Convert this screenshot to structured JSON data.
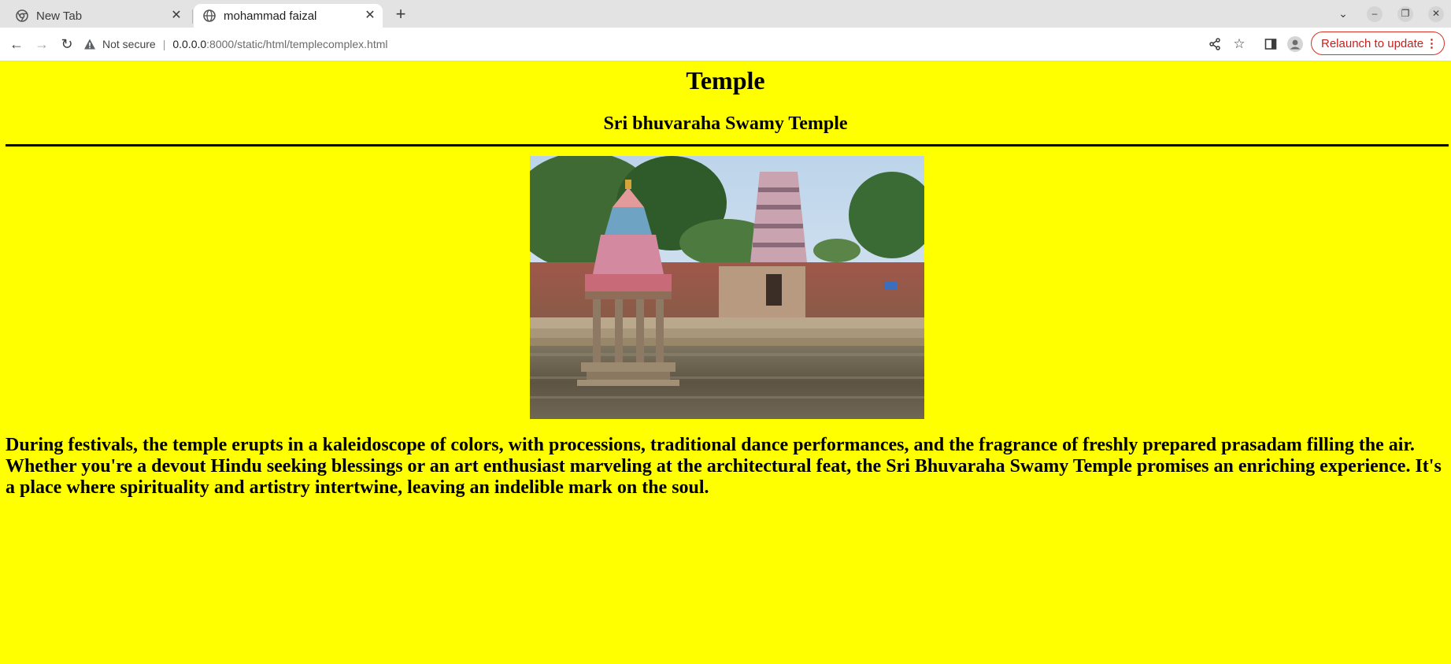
{
  "browser": {
    "tabs": [
      {
        "title": "New Tab",
        "icon": "chrome-icon",
        "active": false
      },
      {
        "title": "mohammad faizal",
        "icon": "globe-icon",
        "active": true
      }
    ],
    "security_label": "Not secure",
    "url_host": "0.0.0.0",
    "url_path": ":8000/static/html/templecomplex.html",
    "relaunch_label": "Relaunch to update"
  },
  "page": {
    "heading": "Temple",
    "subheading": "Sri bhuvaraha Swamy Temple",
    "paragraph": "During festivals, the temple erupts in a kaleidoscope of colors, with processions, traditional dance performances, and the fragrance of freshly prepared prasadam filling the air. Whether you're a devout Hindu seeking blessings or an art enthusiast marveling at the architectural feat, the Sri Bhuvaraha Swamy Temple promises an enriching experience. It's a place where spirituality and artistry intertwine, leaving an indelible mark on the soul.",
    "background_color": "#ffff00"
  }
}
